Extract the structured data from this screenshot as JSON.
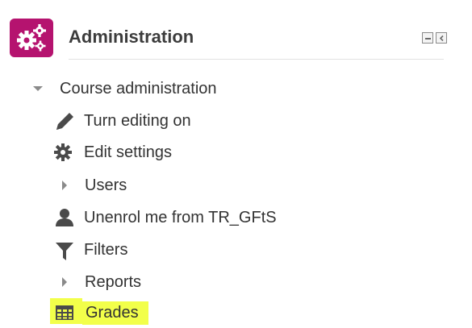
{
  "block": {
    "title": "Administration",
    "accent_color": "#b5136f",
    "highlight_color": "#f2ff4a",
    "icons": {
      "header": "gears-icon",
      "minimize": "minimize-icon",
      "dock": "dock-icon"
    }
  },
  "tree": {
    "section_label": "Course administration",
    "section_icon": "caret-down-icon",
    "items": [
      {
        "label": "Turn editing on",
        "icon": "pencil-icon"
      },
      {
        "label": "Edit settings",
        "icon": "gear-icon"
      },
      {
        "label": "Users",
        "icon": "caret-right-icon"
      },
      {
        "label": "Unenrol me from TR_GFtS",
        "icon": "user-icon"
      },
      {
        "label": "Filters",
        "icon": "filter-icon"
      },
      {
        "label": "Reports",
        "icon": "caret-right-icon"
      },
      {
        "label": "Grades",
        "icon": "table-icon",
        "highlighted": true
      }
    ]
  }
}
